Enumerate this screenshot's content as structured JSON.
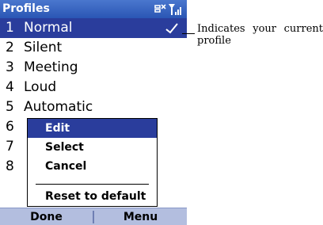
{
  "title": "Profiles",
  "status_icons": [
    "connectivity-icon",
    "signal-icon"
  ],
  "profiles": [
    {
      "num": "1",
      "name": "Normal",
      "checked": true
    },
    {
      "num": "2",
      "name": "Silent"
    },
    {
      "num": "3",
      "name": "Meeting"
    },
    {
      "num": "4",
      "name": "Loud"
    },
    {
      "num": "5",
      "name": "Automatic"
    },
    {
      "num": "6",
      "name": ""
    },
    {
      "num": "7",
      "name": ""
    },
    {
      "num": "8",
      "name": ""
    }
  ],
  "popup_menu": {
    "items": [
      "Edit",
      "Select",
      "Cancel",
      "Reset to default"
    ],
    "highlighted": "Edit"
  },
  "softkeys": {
    "left": "Done",
    "right": "Menu"
  },
  "callout": "Indicates your current profile",
  "colors": {
    "titlebar": "#2a56b4",
    "selection": "#2a3d9c",
    "softkey_bar": "#b3bedf"
  }
}
